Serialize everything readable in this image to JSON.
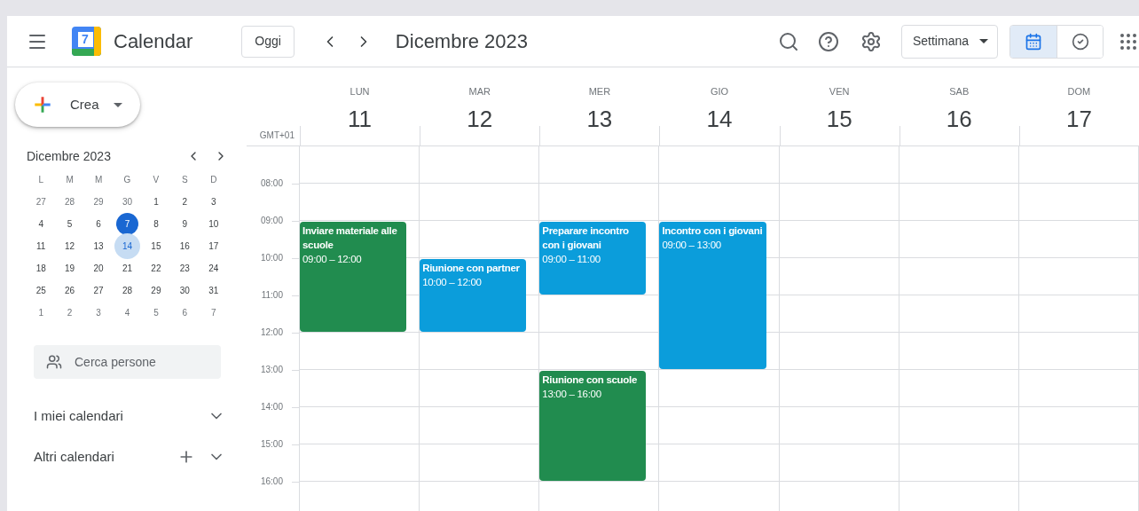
{
  "header": {
    "app_name": "Calendar",
    "logo_text": "7",
    "today_button": "Oggi",
    "period": "Dicembre 2023",
    "view_select": "Settimana",
    "view_toggle": [
      {
        "kind": "calendar",
        "selected": true
      },
      {
        "kind": "tasks",
        "selected": false
      }
    ]
  },
  "sidebar": {
    "create_button": "Crea",
    "mini_calendar": {
      "title": "Dicembre 2023",
      "weekdays": [
        "L",
        "M",
        "M",
        "G",
        "V",
        "S",
        "D"
      ],
      "weeks": [
        [
          {
            "d": "27",
            "muted": true,
            "selected": false,
            "today": false
          },
          {
            "d": "28",
            "muted": true,
            "selected": false,
            "today": false
          },
          {
            "d": "29",
            "muted": true,
            "selected": false,
            "today": false
          },
          {
            "d": "30",
            "muted": true,
            "selected": false,
            "today": false
          },
          {
            "d": "1",
            "muted": false,
            "selected": false,
            "today": false
          },
          {
            "d": "2",
            "muted": false,
            "selected": false,
            "today": false
          },
          {
            "d": "3",
            "muted": false,
            "selected": false,
            "today": false
          }
        ],
        [
          {
            "d": "4",
            "muted": false,
            "selected": false,
            "today": false
          },
          {
            "d": "5",
            "muted": false,
            "selected": false,
            "today": false
          },
          {
            "d": "6",
            "muted": false,
            "selected": false,
            "today": false
          },
          {
            "d": "7",
            "muted": false,
            "selected": false,
            "today": true
          },
          {
            "d": "8",
            "muted": false,
            "selected": false,
            "today": false
          },
          {
            "d": "9",
            "muted": false,
            "selected": false,
            "today": false
          },
          {
            "d": "10",
            "muted": false,
            "selected": false,
            "today": false
          }
        ],
        [
          {
            "d": "11",
            "muted": false,
            "selected": false,
            "today": false
          },
          {
            "d": "12",
            "muted": false,
            "selected": false,
            "today": false
          },
          {
            "d": "13",
            "muted": false,
            "selected": false,
            "today": false
          },
          {
            "d": "14",
            "muted": false,
            "selected": true,
            "today": false
          },
          {
            "d": "15",
            "muted": false,
            "selected": false,
            "today": false
          },
          {
            "d": "16",
            "muted": false,
            "selected": false,
            "today": false
          },
          {
            "d": "17",
            "muted": false,
            "selected": false,
            "today": false
          }
        ],
        [
          {
            "d": "18",
            "muted": false,
            "selected": false,
            "today": false
          },
          {
            "d": "19",
            "muted": false,
            "selected": false,
            "today": false
          },
          {
            "d": "20",
            "muted": false,
            "selected": false,
            "today": false
          },
          {
            "d": "21",
            "muted": false,
            "selected": false,
            "today": false
          },
          {
            "d": "22",
            "muted": false,
            "selected": false,
            "today": false
          },
          {
            "d": "23",
            "muted": false,
            "selected": false,
            "today": false
          },
          {
            "d": "24",
            "muted": false,
            "selected": false,
            "today": false
          }
        ],
        [
          {
            "d": "25",
            "muted": false,
            "selected": false,
            "today": false
          },
          {
            "d": "26",
            "muted": false,
            "selected": false,
            "today": false
          },
          {
            "d": "27",
            "muted": false,
            "selected": false,
            "today": false
          },
          {
            "d": "28",
            "muted": false,
            "selected": false,
            "today": false
          },
          {
            "d": "29",
            "muted": false,
            "selected": false,
            "today": false
          },
          {
            "d": "30",
            "muted": false,
            "selected": false,
            "today": false
          },
          {
            "d": "31",
            "muted": false,
            "selected": false,
            "today": false
          }
        ],
        [
          {
            "d": "1",
            "muted": true,
            "selected": false,
            "today": false
          },
          {
            "d": "2",
            "muted": true,
            "selected": false,
            "today": false
          },
          {
            "d": "3",
            "muted": true,
            "selected": false,
            "today": false
          },
          {
            "d": "4",
            "muted": true,
            "selected": false,
            "today": false
          },
          {
            "d": "5",
            "muted": true,
            "selected": false,
            "today": false
          },
          {
            "d": "6",
            "muted": true,
            "selected": false,
            "today": false
          },
          {
            "d": "7",
            "muted": true,
            "selected": false,
            "today": false
          }
        ]
      ]
    },
    "people_search": {
      "placeholder": "Cerca persone"
    },
    "sections": [
      {
        "label": "I miei calendari",
        "addable": false
      },
      {
        "label": "Altri calendari",
        "addable": true
      }
    ]
  },
  "week": {
    "timezone": "GMT+01",
    "hours": [
      "08:00",
      "09:00",
      "10:00",
      "11:00",
      "12:00",
      "13:00",
      "14:00",
      "15:00",
      "16:00"
    ],
    "days": [
      {
        "name": "LUN",
        "number": "11",
        "events": [
          {
            "title": "Inviare materiale alle scuole",
            "time": "09:00 – 12:00",
            "color": "#218c4f"
          }
        ]
      },
      {
        "name": "MAR",
        "number": "12",
        "events": [
          {
            "title": "Riunione con partner",
            "time": "10:00 – 12:00",
            "color": "#0b9ddb"
          }
        ]
      },
      {
        "name": "MER",
        "number": "13",
        "events": [
          {
            "title": "Preparare incontro con i giovani",
            "time": "09:00 – 11:00",
            "color": "#0b9ddb"
          },
          {
            "title": "Riunione con scuole",
            "time": "13:00 – 16:00",
            "color": "#218c4f"
          }
        ]
      },
      {
        "name": "GIO",
        "number": "14",
        "events": [
          {
            "title": "Incontro con i giovani",
            "time": "09:00 – 13:00",
            "color": "#0b9ddb"
          }
        ]
      },
      {
        "name": "VEN",
        "number": "15"
      },
      {
        "name": "SAB",
        "number": "16"
      },
      {
        "name": "DOM",
        "number": "17"
      }
    ]
  }
}
